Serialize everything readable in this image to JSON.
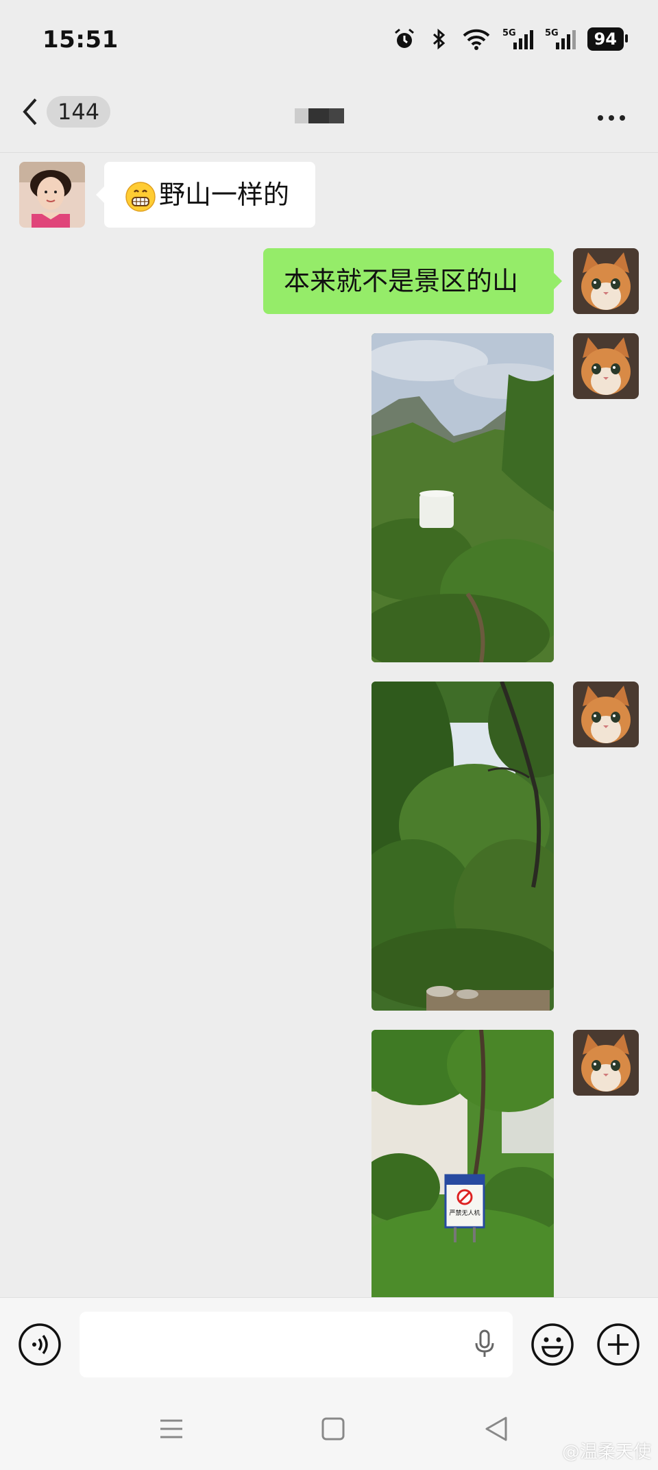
{
  "status_bar": {
    "time": "15:51",
    "battery": "94",
    "icons": [
      "alarm-icon",
      "bluetooth-icon",
      "wifi-icon",
      "signal-5g-icon",
      "signal-5g-icon"
    ]
  },
  "nav": {
    "unread_count": "144",
    "title_obscured": true
  },
  "messages": [
    {
      "side": "left",
      "text": "野山一样的",
      "emoji": "grinning-face"
    },
    {
      "side": "right",
      "text": "本来就不是景区的山"
    },
    {
      "side": "right",
      "type": "image",
      "subject": "mountain-peaks-vegetation"
    },
    {
      "side": "right",
      "type": "image",
      "subject": "dense-green-trees"
    },
    {
      "side": "right",
      "type": "image",
      "subject": "trees-with-sign"
    }
  ],
  "photo3_sign": {
    "line1": "严禁无人机"
  },
  "watermark": "@温柔天使",
  "colors": {
    "background": "#ededed",
    "sent_bubble": "#95ec69",
    "received_bubble": "#ffffff"
  }
}
